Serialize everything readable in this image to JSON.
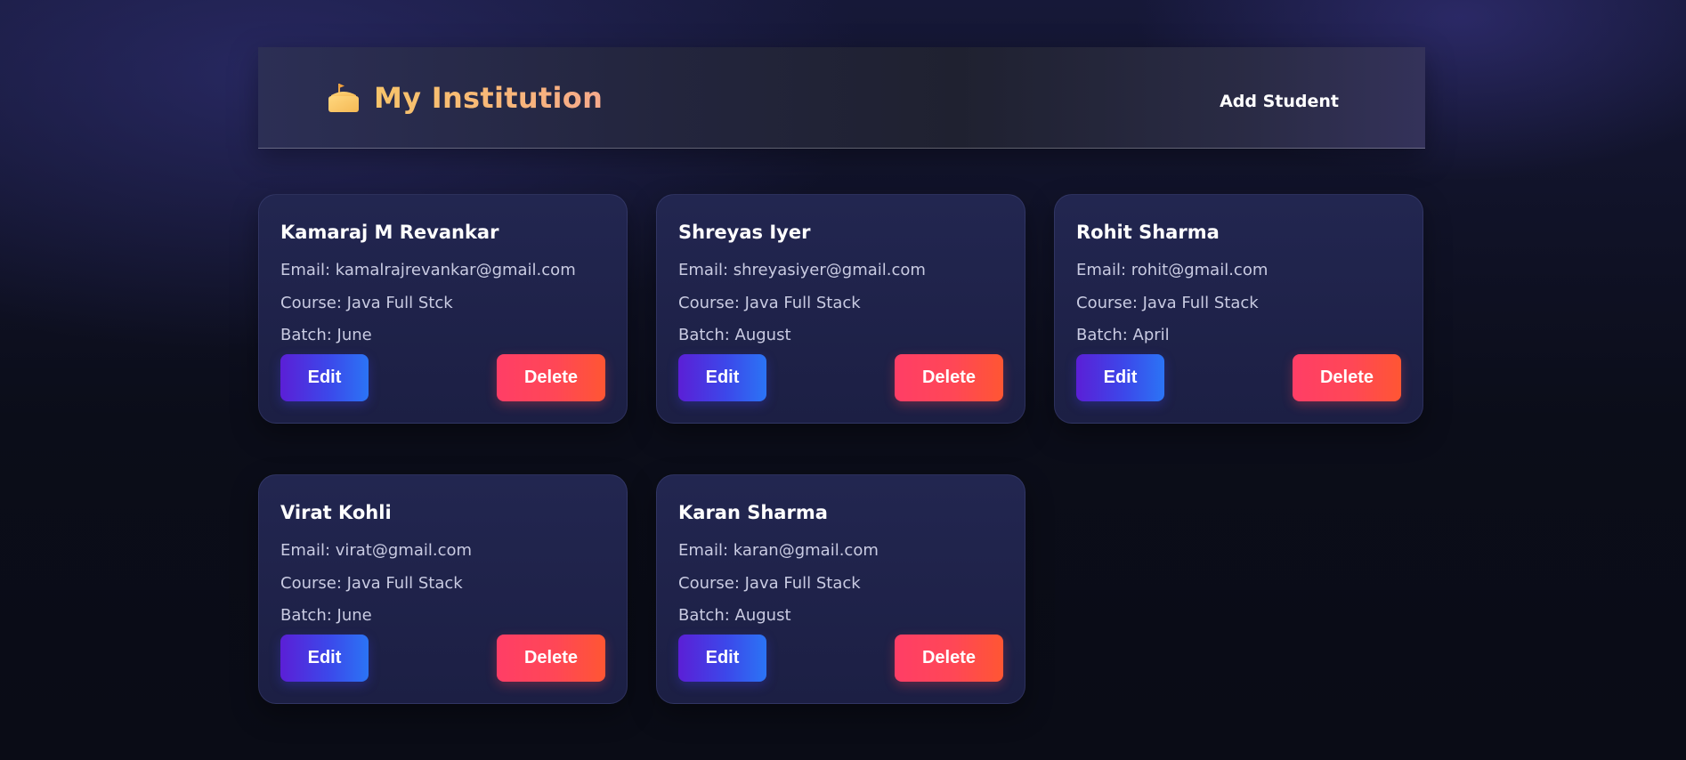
{
  "header": {
    "brand_icon": "mosque-building-icon",
    "brand_title": "My Institution",
    "add_student_label": "Add Student"
  },
  "colors": {
    "brand_gradient": [
      "#f7c46a",
      "#f6a98c"
    ],
    "edit_gradient": [
      "#5b1fd6",
      "#2b74f5"
    ],
    "delete_gradient": [
      "#ff3e66",
      "#ff5633"
    ],
    "card_background": "#202349"
  },
  "students": [
    {
      "name": "Kamaraj M Revankar",
      "email": "Email: kamalrajrevankar@gmail.com",
      "course": "Course: Java Full Stck",
      "batch": "Batch: June",
      "edit_label": "Edit",
      "delete_label": "Delete"
    },
    {
      "name": "Shreyas Iyer",
      "email": "Email: shreyasiyer@gmail.com",
      "course": "Course: Java Full Stack",
      "batch": "Batch: August",
      "edit_label": "Edit",
      "delete_label": "Delete"
    },
    {
      "name": "Rohit Sharma",
      "email": "Email: rohit@gmail.com",
      "course": "Course: Java Full Stack",
      "batch": "Batch: April",
      "edit_label": "Edit",
      "delete_label": "Delete"
    },
    {
      "name": "Virat Kohli",
      "email": "Email: virat@gmail.com",
      "course": "Course: Java Full Stack",
      "batch": "Batch: June",
      "edit_label": "Edit",
      "delete_label": "Delete"
    },
    {
      "name": "Karan Sharma",
      "email": "Email: karan@gmail.com",
      "course": "Course: Java Full Stack",
      "batch": "Batch: August",
      "edit_label": "Edit",
      "delete_label": "Delete"
    }
  ]
}
